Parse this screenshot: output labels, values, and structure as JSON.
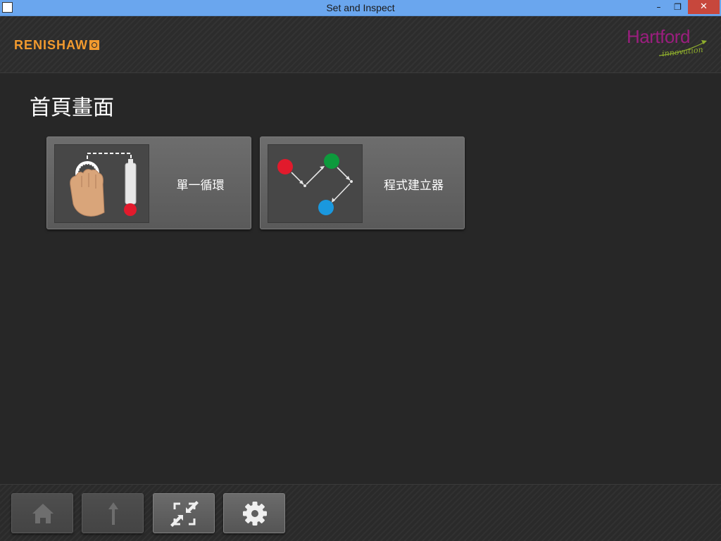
{
  "window": {
    "title": "Set and Inspect",
    "controls": {
      "minimize": "–",
      "maximize": "❐",
      "close": "✕"
    }
  },
  "header": {
    "left_logo": "RENISHAW",
    "right_logo": {
      "name": "Hartford",
      "tagline": "innovation"
    }
  },
  "page": {
    "title": "首頁畫面"
  },
  "tiles": [
    {
      "label": "單一循環",
      "icon": "hand-probe-icon"
    },
    {
      "label": "程式建立器",
      "icon": "program-path-icon"
    }
  ],
  "bottom_bar": [
    {
      "name": "home-button",
      "icon": "home-icon",
      "enabled": false
    },
    {
      "name": "up-button",
      "icon": "arrow-up-icon",
      "enabled": false
    },
    {
      "name": "shrink-button",
      "icon": "shrink-icon",
      "enabled": true
    },
    {
      "name": "settings-button",
      "icon": "gear-icon",
      "enabled": true
    }
  ],
  "colors": {
    "titlebar": "#6aa6ee",
    "background": "#272727",
    "renishaw_orange": "#f29a2e",
    "hartford_purple": "#9a1e7e",
    "hartford_green": "#8fae2c",
    "close_red": "#c7473c",
    "point_red": "#e21a2c",
    "point_green": "#0d9a3c",
    "point_blue": "#1a98de"
  }
}
